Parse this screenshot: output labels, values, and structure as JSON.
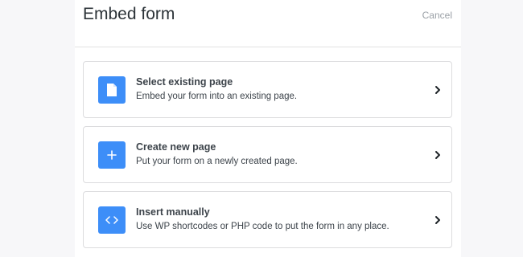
{
  "modal": {
    "title": "Embed form",
    "cancel_label": "Cancel"
  },
  "options": [
    {
      "title": "Select existing page",
      "description": "Embed your form into an existing page.",
      "icon": "page-icon"
    },
    {
      "title": "Create new page",
      "description": "Put your form on a newly created page.",
      "icon": "plus-icon"
    },
    {
      "title": "Insert manually",
      "description": "Use WP shortcodes or PHP code to put the form in any place.",
      "icon": "code-icon"
    }
  ],
  "colors": {
    "accent": "#3d8ef8",
    "border": "#dcdcde",
    "text": "#3c434a",
    "muted": "#9aa0a6"
  }
}
